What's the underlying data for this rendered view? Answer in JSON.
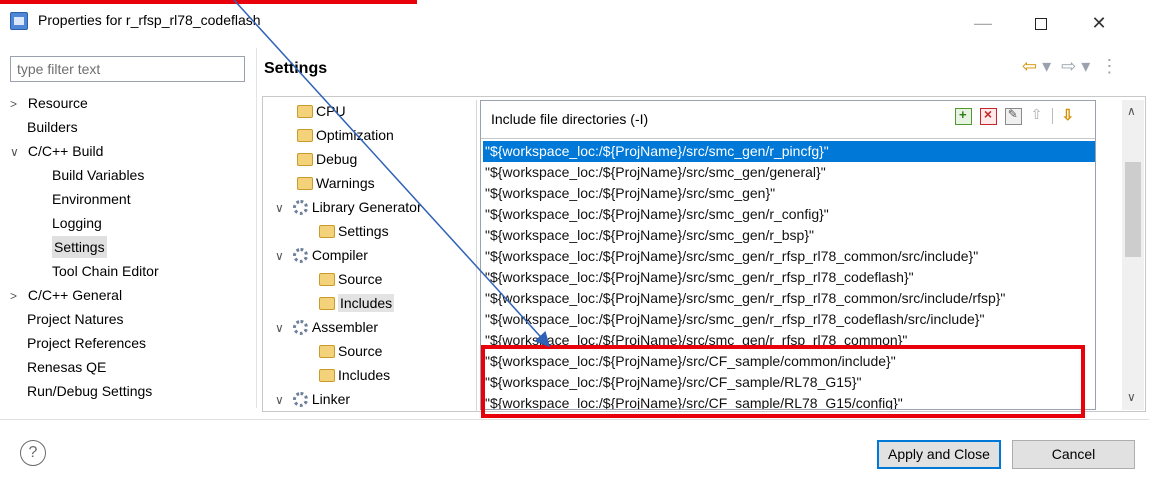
{
  "window": {
    "title": "Properties for r_rfsp_rl78_codeflash",
    "minimize": "—",
    "close": "✕"
  },
  "sidebar": {
    "filter_placeholder": "type filter text",
    "items": [
      {
        "label": "Resource",
        "twisty": ">"
      },
      {
        "label": "Builders",
        "twisty": ""
      },
      {
        "label": "C/C++ Build",
        "twisty": "∨"
      },
      {
        "label": "Build Variables",
        "twisty": ""
      },
      {
        "label": "Environment",
        "twisty": ""
      },
      {
        "label": "Logging",
        "twisty": ""
      },
      {
        "label": "Settings",
        "twisty": "",
        "selected": true
      },
      {
        "label": "Tool Chain Editor",
        "twisty": ""
      },
      {
        "label": "C/C++ General",
        "twisty": ">"
      },
      {
        "label": "Project Natures",
        "twisty": ""
      },
      {
        "label": "Project References",
        "twisty": ""
      },
      {
        "label": "Renesas QE",
        "twisty": ""
      },
      {
        "label": "Run/Debug Settings",
        "twisty": ""
      }
    ]
  },
  "main": {
    "title": "Settings",
    "nav": {
      "back": "⇦",
      "back_menu": "▾",
      "forward": "⇨",
      "forward_menu": "▾",
      "more": "⋮"
    }
  },
  "tool_tree": {
    "items": [
      {
        "label": "CPU",
        "kind": "folder",
        "twisty": ""
      },
      {
        "label": "Optimization",
        "kind": "folder",
        "twisty": ""
      },
      {
        "label": "Debug",
        "kind": "folder",
        "twisty": ""
      },
      {
        "label": "Warnings",
        "kind": "folder",
        "twisty": ""
      },
      {
        "label": "Library Generator",
        "kind": "gear",
        "twisty": "∨"
      },
      {
        "label": "Settings",
        "kind": "folder",
        "twisty": ""
      },
      {
        "label": "Compiler",
        "kind": "gear",
        "twisty": "∨"
      },
      {
        "label": "Source",
        "kind": "folder",
        "twisty": ""
      },
      {
        "label": "Includes",
        "kind": "folder",
        "twisty": "",
        "selected": true
      },
      {
        "label": "Assembler",
        "kind": "gear",
        "twisty": "∨"
      },
      {
        "label": "Source",
        "kind": "folder",
        "twisty": ""
      },
      {
        "label": "Includes",
        "kind": "folder",
        "twisty": ""
      },
      {
        "label": "Linker",
        "kind": "gear",
        "twisty": "∨"
      }
    ]
  },
  "include_panel": {
    "title": "Include file directories (-I)",
    "tools": [
      "add-icon",
      "delete-icon",
      "edit-icon",
      "move-up-icon",
      "move-down-icon"
    ],
    "rows": [
      "\"${workspace_loc:/${ProjName}/src/smc_gen/r_pincfg}\"",
      "\"${workspace_loc:/${ProjName}/src/smc_gen/general}\"",
      "\"${workspace_loc:/${ProjName}/src/smc_gen}\"",
      "\"${workspace_loc:/${ProjName}/src/smc_gen/r_config}\"",
      "\"${workspace_loc:/${ProjName}/src/smc_gen/r_bsp}\"",
      "\"${workspace_loc:/${ProjName}/src/smc_gen/r_rfsp_rl78_common/src/include}\"",
      "\"${workspace_loc:/${ProjName}/src/smc_gen/r_rfsp_rl78_codeflash}\"",
      "\"${workspace_loc:/${ProjName}/src/smc_gen/r_rfsp_rl78_common/src/include/rfsp}\"",
      "\"${workspace_loc:/${ProjName}/src/smc_gen/r_rfsp_rl78_codeflash/src/include}\"",
      "\"${workspace_loc:/${ProjName}/src/smc_gen/r_rfsp_rl78_common}\"",
      "\"${workspace_loc:/${ProjName}/src/CF_sample/common/include}\"",
      "\"${workspace_loc:/${ProjName}/src/CF_sample/RL78_G15}\"",
      "\"${workspace_loc:/${ProjName}/src/CF_sample/RL78_G15/config}\""
    ],
    "selected_index": 0
  },
  "footer": {
    "help": "?",
    "apply_label": "Apply and Close",
    "cancel_label": "Cancel"
  },
  "colors": {
    "selection": "#0078d7",
    "annotation": "#e8000b",
    "arrow": "#2f62b7"
  }
}
